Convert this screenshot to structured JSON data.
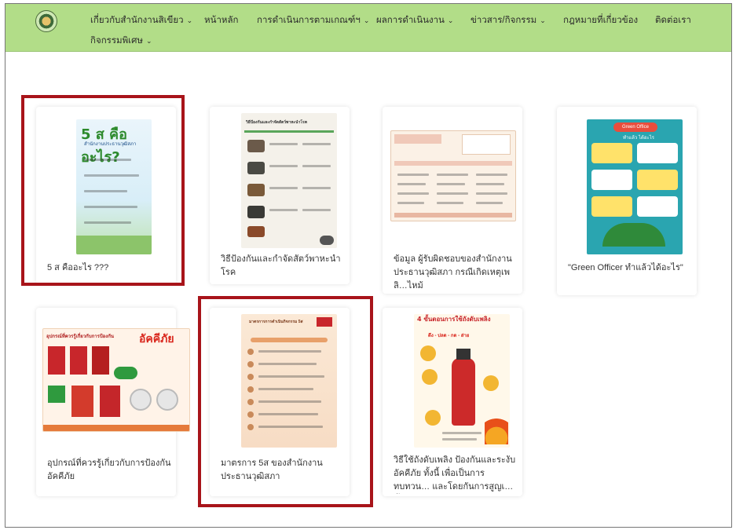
{
  "nav": {
    "items": [
      {
        "label": "เกี่ยวกับสำนักงานสิเขียว",
        "dropdown": true
      },
      {
        "label": "หน้าหลัก",
        "dropdown": false
      },
      {
        "label": "การดำเนินการตามเกณฑ์ฯ",
        "dropdown": true
      },
      {
        "label": "ผลการดำเนินงาน",
        "dropdown": true
      },
      {
        "label": "ข่าวสาร/กิจกรรม",
        "dropdown": true
      },
      {
        "label": "กฎหมายที่เกี่ยวข้อง",
        "dropdown": false
      },
      {
        "label": "ติดต่อเรา",
        "dropdown": false
      },
      {
        "label": "กิจกรรมพิเศษ",
        "dropdown": true
      }
    ],
    "caret": "⌄"
  },
  "cards": [
    {
      "title": "5 ส คืออะไร ???",
      "poster": {
        "heading": "5 ส คืออะไร?",
        "sub": "สำนักงานประธานวุฒิสภา"
      }
    },
    {
      "title": "วิธีป้องกันและกำจัดสัตว์พาหะนำโรค",
      "poster": {
        "heading": "วิธีป้องกันและกำจัดสัตว์พาหะนำโรค"
      }
    },
    {
      "title": "ข้อมูล ผู้รับผิดชอบของสำนักงานประธานวุฒิสภา กรณีเกิดเหตุเพลิ…ไหม้",
      "poster": {}
    },
    {
      "title": "\"Green Officer ทำแล้วได้อะไร\"",
      "poster": {
        "heading": "Green Office",
        "sub": "ทำแล้ว ได้อะไร"
      }
    },
    {
      "title": "อุปกรณ์ที่ควรรู้เกี่ยวกับการป้องกันอัคคีภัย",
      "poster": {
        "heading": "อุปกรณ์ที่ควรรู้เกี่ยวกับการป้องกัน",
        "accent": "อัคคีภัย"
      }
    },
    {
      "title": "มาตรการ 5ส ของสำนักงานประธานวุฒิสภา",
      "poster": {
        "heading": "มาตรการการดำเนินกิจกรรม 5ส"
      }
    },
    {
      "title": "วิธีใช้ถังดับเพลิง ป้องกันและระงับอัคคีภัย ทั้งนี้ เพื่อเป็นการทบทวน… และโดยกันการสูญเสียทั้งชีวิตและ",
      "poster": {
        "heading": "4 ขั้นตอนการใช้ถังดับเพลิง",
        "steps": "ดึง - ปลด - กด - ส่าย"
      }
    }
  ],
  "colors": {
    "navbar": "#b2dd88",
    "highlight": "#a8141a",
    "accent_red": "#d9261c",
    "green": "#2f8a3a"
  }
}
